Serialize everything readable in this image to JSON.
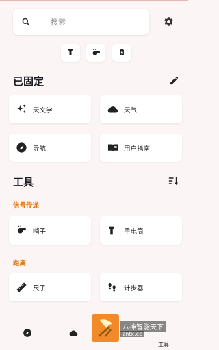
{
  "search": {
    "placeholder": "搜索"
  },
  "pinned": {
    "title": "已固定",
    "tools": [
      {
        "label": "天文学",
        "icon": "sparkles-icon"
      },
      {
        "label": "天气",
        "icon": "cloud-icon"
      },
      {
        "label": "导航",
        "icon": "compass-icon"
      },
      {
        "label": "用户指南",
        "icon": "book-icon"
      }
    ]
  },
  "tools_section": {
    "title": "工具",
    "categories": [
      {
        "name": "信号传递",
        "items": [
          {
            "label": "哨子",
            "icon": "whistle-icon"
          },
          {
            "label": "手电筒",
            "icon": "flashlight-icon"
          }
        ]
      },
      {
        "name": "距离",
        "items": [
          {
            "label": "尺子",
            "icon": "ruler-icon"
          },
          {
            "label": "计步器",
            "icon": "footsteps-icon"
          }
        ]
      }
    ]
  },
  "bottom_nav": {
    "tools_label": "工具"
  },
  "watermark": {
    "line1": "八神智能天下",
    "line2": "zntx.cc"
  },
  "colors": {
    "background": "#fcf5f6",
    "category": "#e07a12",
    "card": "#ffffff"
  }
}
